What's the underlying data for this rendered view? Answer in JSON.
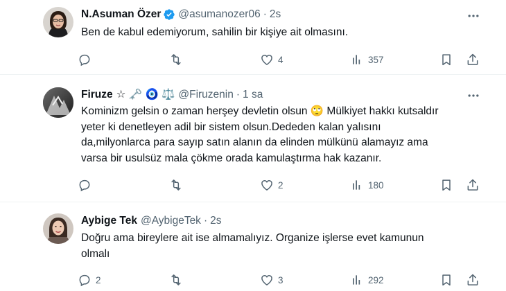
{
  "tweets": [
    {
      "name": "N.Asuman Özer",
      "verified": true,
      "handle": "@asumanozer06",
      "time": "2s",
      "text_lines": [
        "Ben de kabul edemiyorum, sahilin bir kişiye ait olmasını."
      ],
      "replies": "",
      "retweets": "",
      "likes": "4",
      "views": "357"
    },
    {
      "name": "Firuze",
      "name_suffix": "☆ 🗝️ 🧿 ⚖️",
      "handle": "@Firuzenin",
      "time": "1 sa",
      "text_lines": [
        "Kominizm gelsin o zaman herşey devletin olsun 🙄 Mülkiyet hakkı kutsaldır",
        "yeter ki denetleyen adil bir sistem olsun.Dededen kalan  yalısını",
        "da,milyonlarca para sayıp satın alanın da elinden mülkünü alamayız ama",
        "varsa bir usulsüz mala çökme orada kamulaştırma hak kazanır."
      ],
      "replies": "",
      "retweets": "",
      "likes": "2",
      "views": "180"
    },
    {
      "name": "Aybige Tek",
      "handle": "@AybigeTek",
      "time": "2s",
      "text_lines": [
        "Doğru ama bireylere ait ise almamalıyız. Organize işlerse evet kamunun",
        "olmalı"
      ],
      "replies": "2",
      "retweets": "",
      "likes": "3",
      "views": "292"
    }
  ],
  "icons": {
    "reply": "reply-icon",
    "retweet": "retweet-icon",
    "like": "heart-icon",
    "views": "views-icon",
    "bookmark": "bookmark-icon",
    "share": "share-icon",
    "more": "more-icon",
    "verified": "verified-badge-icon"
  },
  "colors": {
    "verified": "#1d9bf0",
    "muted": "#536471",
    "text": "#0f1419"
  }
}
